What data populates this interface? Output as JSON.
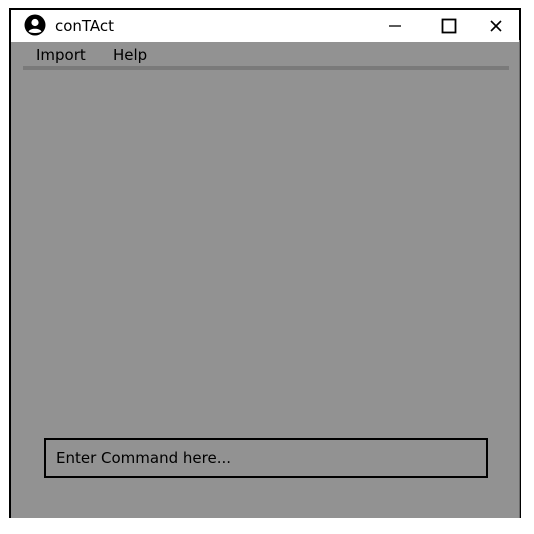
{
  "window": {
    "title": "conTAct",
    "minimize_glyph": "–",
    "maximize_glyph": "☐",
    "close_glyph": "×"
  },
  "menu": {
    "items": [
      {
        "label": "Import"
      },
      {
        "label": "Help"
      }
    ]
  },
  "command": {
    "placeholder": "Enter Command here...",
    "value": ""
  },
  "icons": {
    "app": "user-circle-icon"
  },
  "colors": {
    "background": "#929292",
    "titlebar": "#ffffff"
  }
}
